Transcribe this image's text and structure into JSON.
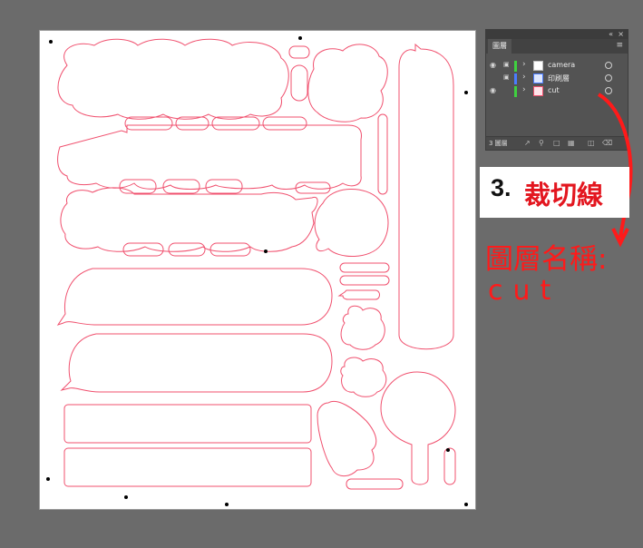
{
  "layers_panel": {
    "collapse_icon": "double-chevron-left-icon",
    "close_icon": "close-icon",
    "tab_label": "圖層",
    "menu_icon": "hamburger-menu-icon",
    "layers": [
      {
        "name": "camera",
        "visible": true,
        "locked": true,
        "color": "#3fd13f"
      },
      {
        "name": "印刷層",
        "visible": false,
        "locked": true,
        "color": "#4a7cff"
      },
      {
        "name": "cut",
        "visible": true,
        "locked": false,
        "color": "#3fd13f"
      }
    ],
    "layer_count": "3 圖層"
  },
  "annotation": {
    "step_number": "3.",
    "step_title": "裁切線",
    "note_line1": "圖層名稱:",
    "note_line2": "cut",
    "color": "#ff1a1a"
  },
  "colors": {
    "cut_line": "#f0506e",
    "workspace": "#6b6b6b",
    "artboard": "#ffffff"
  }
}
